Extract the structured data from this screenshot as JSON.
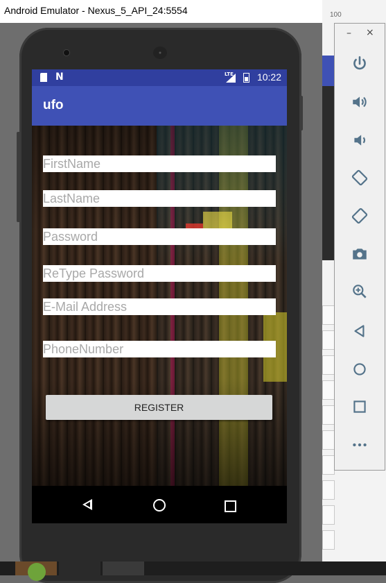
{
  "window": {
    "title": "Android Emulator - Nexus_5_API_24:5554"
  },
  "background_app": {
    "ruler_label": "100"
  },
  "statusbar": {
    "time": "10:22",
    "network": "LTE"
  },
  "app": {
    "title": "ufo"
  },
  "form": {
    "firstname_placeholder": "FirstName",
    "lastname_placeholder": "LastName",
    "password_placeholder": "Password",
    "retype_password_placeholder": "ReType Password",
    "email_placeholder": "E-Mail Address",
    "phone_placeholder": "PhoneNumber",
    "register_label": "REGISTER"
  },
  "toolbar": {
    "minimize": "–",
    "close": "×",
    "buttons": [
      "power-icon",
      "volume-up-icon",
      "volume-down-icon",
      "rotate-left-icon",
      "rotate-right-icon",
      "camera-icon",
      "zoom-icon",
      "back-icon",
      "home-icon",
      "overview-icon",
      "more-icon"
    ]
  },
  "colors": {
    "appbar": "#3f51b5",
    "statusbar": "#303f9f",
    "button": "#d6d7d7",
    "toolbar_icon": "#54738a"
  }
}
